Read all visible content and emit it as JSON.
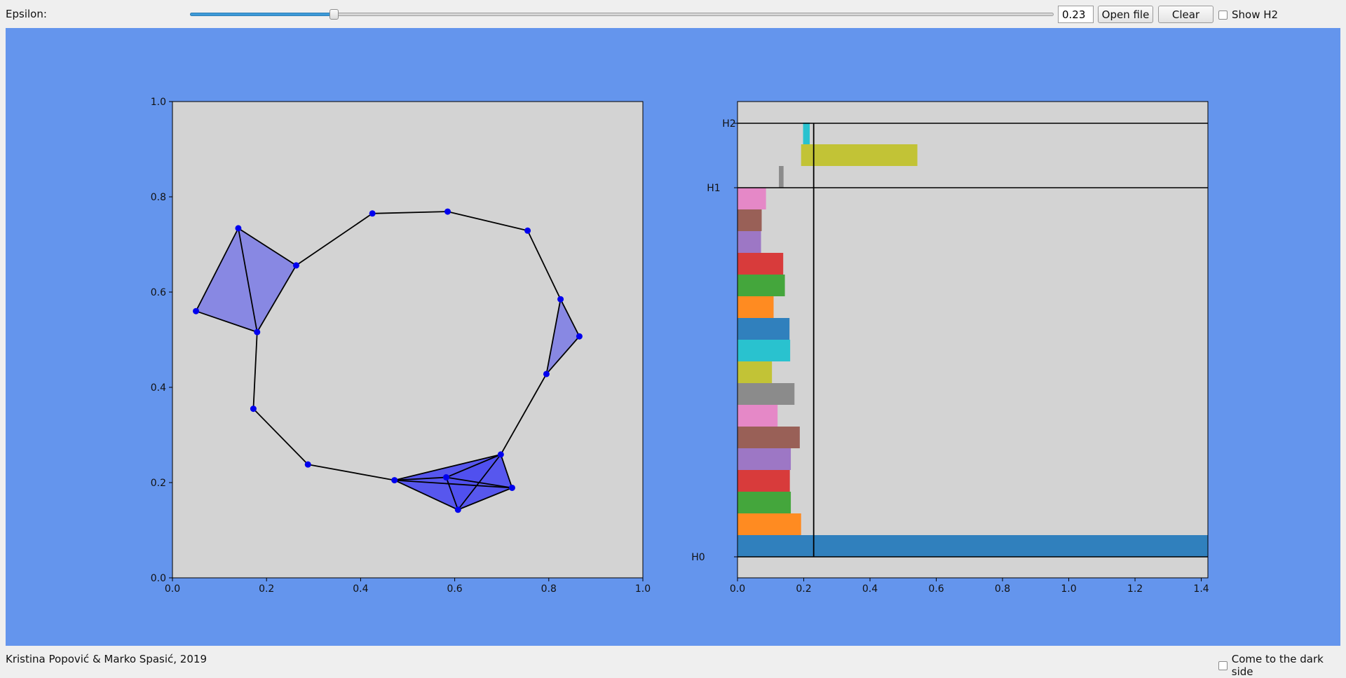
{
  "toolbar": {
    "epsilon_label": "Epsilon:",
    "epsilon_value": "0.23",
    "slider_fraction": 0.166,
    "open_label": "Open file",
    "clear_label": "Clear",
    "show_h2_label": "Show H2",
    "show_h2_checked": false
  },
  "footer": {
    "credit": "Kristina Popović & Marko Spasić, 2019",
    "dark_side_label": "Come to the dark side",
    "dark_side_checked": false
  },
  "colors": {
    "background": "#6495ed",
    "plot_bg": "#d3d3d3",
    "point": "#0000ee",
    "triangle": "#4a4af0"
  },
  "chart_data": [
    {
      "type": "scatter",
      "title": "",
      "xlabel": "",
      "ylabel": "",
      "xlim": [
        0,
        1
      ],
      "ylim": [
        0,
        1
      ],
      "xticks": [
        "0.0",
        "0.2",
        "0.4",
        "0.6",
        "0.8",
        "1.0"
      ],
      "yticks": [
        "0.0",
        "0.2",
        "0.4",
        "0.6",
        "0.8",
        "1.0"
      ],
      "points": [
        [
          0.14,
          0.734
        ],
        [
          0.263,
          0.656
        ],
        [
          0.05,
          0.56
        ],
        [
          0.18,
          0.516
        ],
        [
          0.425,
          0.765
        ],
        [
          0.585,
          0.769
        ],
        [
          0.755,
          0.729
        ],
        [
          0.825,
          0.585
        ],
        [
          0.865,
          0.507
        ],
        [
          0.795,
          0.428
        ],
        [
          0.172,
          0.355
        ],
        [
          0.288,
          0.238
        ],
        [
          0.472,
          0.205
        ],
        [
          0.582,
          0.211
        ],
        [
          0.698,
          0.259
        ],
        [
          0.722,
          0.189
        ],
        [
          0.607,
          0.143
        ]
      ],
      "edges": [
        [
          0,
          1
        ],
        [
          0,
          2
        ],
        [
          0,
          3
        ],
        [
          1,
          3
        ],
        [
          2,
          3
        ],
        [
          1,
          4
        ],
        [
          4,
          5
        ],
        [
          5,
          6
        ],
        [
          6,
          7
        ],
        [
          7,
          8
        ],
        [
          7,
          9
        ],
        [
          8,
          9
        ],
        [
          9,
          14
        ],
        [
          3,
          10
        ],
        [
          10,
          11
        ],
        [
          11,
          12
        ],
        [
          12,
          13
        ],
        [
          12,
          14
        ],
        [
          12,
          15
        ],
        [
          12,
          16
        ],
        [
          13,
          14
        ],
        [
          13,
          15
        ],
        [
          13,
          16
        ],
        [
          14,
          15
        ],
        [
          14,
          16
        ],
        [
          15,
          16
        ]
      ],
      "triangles": [
        [
          0,
          1,
          3
        ],
        [
          0,
          2,
          3
        ],
        [
          7,
          8,
          9
        ],
        [
          12,
          13,
          14
        ],
        [
          12,
          13,
          16
        ],
        [
          12,
          14,
          15
        ],
        [
          12,
          15,
          16
        ],
        [
          13,
          14,
          15
        ],
        [
          13,
          14,
          16
        ],
        [
          13,
          15,
          16
        ],
        [
          14,
          15,
          16
        ],
        [
          12,
          14,
          16
        ]
      ]
    },
    {
      "type": "bar",
      "title": "",
      "xlabel": "",
      "ylabel": "",
      "xlim": [
        0,
        1.42
      ],
      "xticks": [
        "0.0",
        "0.2",
        "0.4",
        "0.6",
        "0.8",
        "1.0",
        "1.2",
        "1.4"
      ],
      "ylabels": [
        "H0",
        "H1",
        "H2"
      ],
      "epsilon": 0.23,
      "series": [
        {
          "group": "H0",
          "start": 0,
          "end": 1.42,
          "color": "#3080bd"
        },
        {
          "group": "H0",
          "start": 0,
          "end": 0.192,
          "color": "#ff8b21"
        },
        {
          "group": "H0",
          "start": 0,
          "end": 0.161,
          "color": "#44a63c"
        },
        {
          "group": "H0",
          "start": 0,
          "end": 0.158,
          "color": "#d83b3b"
        },
        {
          "group": "H0",
          "start": 0,
          "end": 0.161,
          "color": "#9d77c5"
        },
        {
          "group": "H0",
          "start": 0,
          "end": 0.188,
          "color": "#996057"
        },
        {
          "group": "H0",
          "start": 0,
          "end": 0.121,
          "color": "#e588c7"
        },
        {
          "group": "H0",
          "start": 0,
          "end": 0.172,
          "color": "#8b8b8b"
        },
        {
          "group": "H0",
          "start": 0,
          "end": 0.104,
          "color": "#c2c336"
        },
        {
          "group": "H0",
          "start": 0,
          "end": 0.159,
          "color": "#29c2cf"
        },
        {
          "group": "H0",
          "start": 0,
          "end": 0.157,
          "color": "#3080bd"
        },
        {
          "group": "H0",
          "start": 0,
          "end": 0.109,
          "color": "#ff8b21"
        },
        {
          "group": "H0",
          "start": 0,
          "end": 0.143,
          "color": "#44a63c"
        },
        {
          "group": "H0",
          "start": 0,
          "end": 0.138,
          "color": "#d83b3b"
        },
        {
          "group": "H0",
          "start": 0,
          "end": 0.071,
          "color": "#9d77c5"
        },
        {
          "group": "H0",
          "start": 0,
          "end": 0.073,
          "color": "#996057"
        },
        {
          "group": "H0",
          "start": 0,
          "end": 0.086,
          "color": "#e588c7"
        },
        {
          "group": "H1",
          "start": 0.125,
          "end": 0.139,
          "color": "#8b8b8b"
        },
        {
          "group": "H1",
          "start": 0.192,
          "end": 0.543,
          "color": "#c2c336"
        },
        {
          "group": "H1",
          "start": 0.198,
          "end": 0.218,
          "color": "#29c2cf"
        }
      ]
    }
  ]
}
